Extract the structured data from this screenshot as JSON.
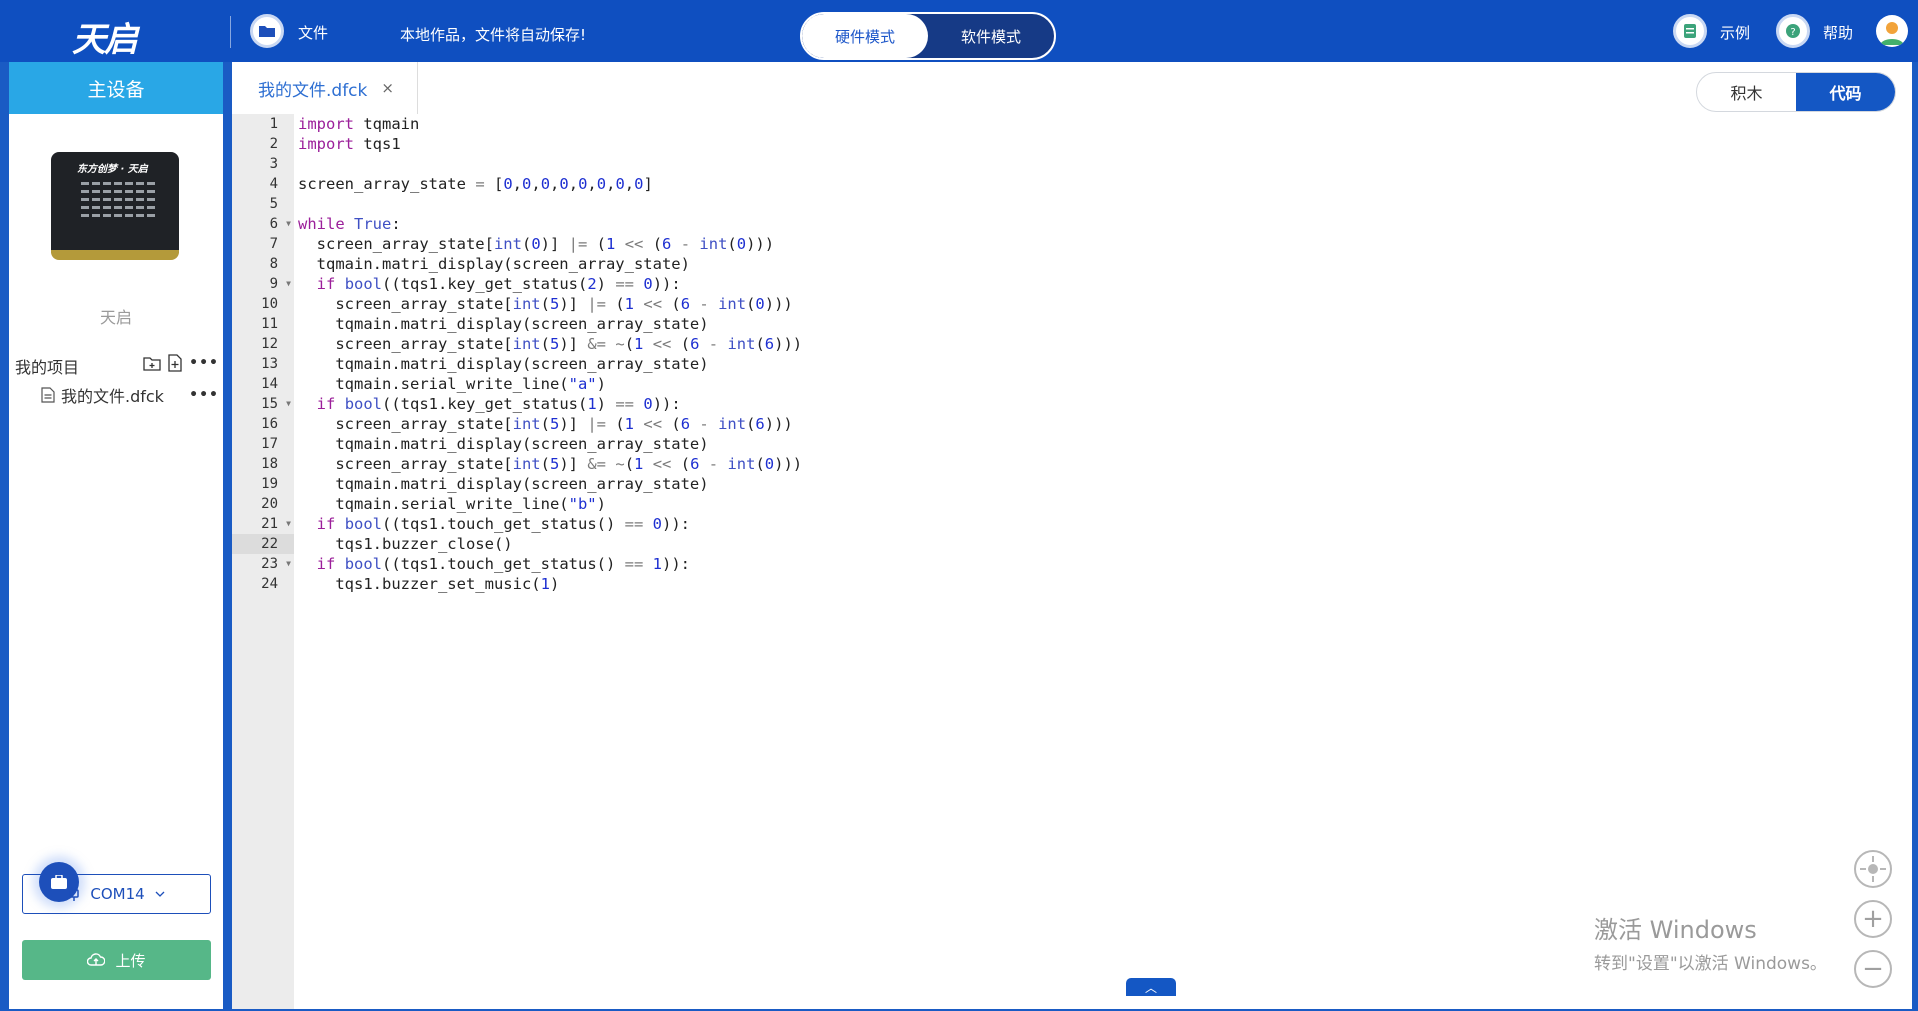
{
  "header": {
    "logo": "天启",
    "file_label": "文件",
    "autosave_notice": "本地作品，文件将自动保存!",
    "modes": [
      "硬件模式",
      "软件模式"
    ],
    "examples_label": "示例",
    "help_label": "帮助"
  },
  "sidebar": {
    "title": "主设备",
    "board_title": "东方创梦 · 天启",
    "board_label": "天启",
    "project_label": "我的项目",
    "file_name": "我的文件.dfck",
    "com_port": "COM14",
    "upload_label": "上传"
  },
  "editor": {
    "tab_name": "我的文件.dfck",
    "tab_close": "×",
    "view_toggle": [
      "积木",
      "代码"
    ],
    "active_line": 22,
    "fold_lines": [
      6,
      9,
      15,
      21,
      23
    ],
    "lines": [
      "import tqmain",
      "import tqs1",
      "",
      "screen_array_state = [0,0,0,0,0,0,0,0]",
      "",
      "while True:",
      "  screen_array_state[int(0)] |= (1 << (6 - int(0)))",
      "  tqmain.matri_display(screen_array_state)",
      "  if bool((tqs1.key_get_status(2) == 0)):",
      "    screen_array_state[int(5)] |= (1 << (6 - int(0)))",
      "    tqmain.matri_display(screen_array_state)",
      "    screen_array_state[int(5)] &= ~(1 << (6 - int(6)))",
      "    tqmain.matri_display(screen_array_state)",
      "    tqmain.serial_write_line(\"a\")",
      "  if bool((tqs1.key_get_status(1) == 0)):",
      "    screen_array_state[int(5)] |= (1 << (6 - int(6)))",
      "    tqmain.matri_display(screen_array_state)",
      "    screen_array_state[int(5)] &= ~(1 << (6 - int(0)))",
      "    tqmain.matri_display(screen_array_state)",
      "    tqmain.serial_write_line(\"b\")",
      "  if bool((tqs1.touch_get_status() == 0)):",
      "    tqs1.buzzer_close()",
      "  if bool((tqs1.touch_get_status() == 1)):",
      "    tqs1.buzzer_set_music(1)"
    ]
  },
  "watermark": {
    "line1": "激活 Windows",
    "line2": "转到\"设置\"以激活 Windows。"
  },
  "colors": {
    "header_bg": "#0f4fc0",
    "sidebar_head": "#29a7e6",
    "upload_btn": "#56b788",
    "accent": "#1457c4"
  }
}
